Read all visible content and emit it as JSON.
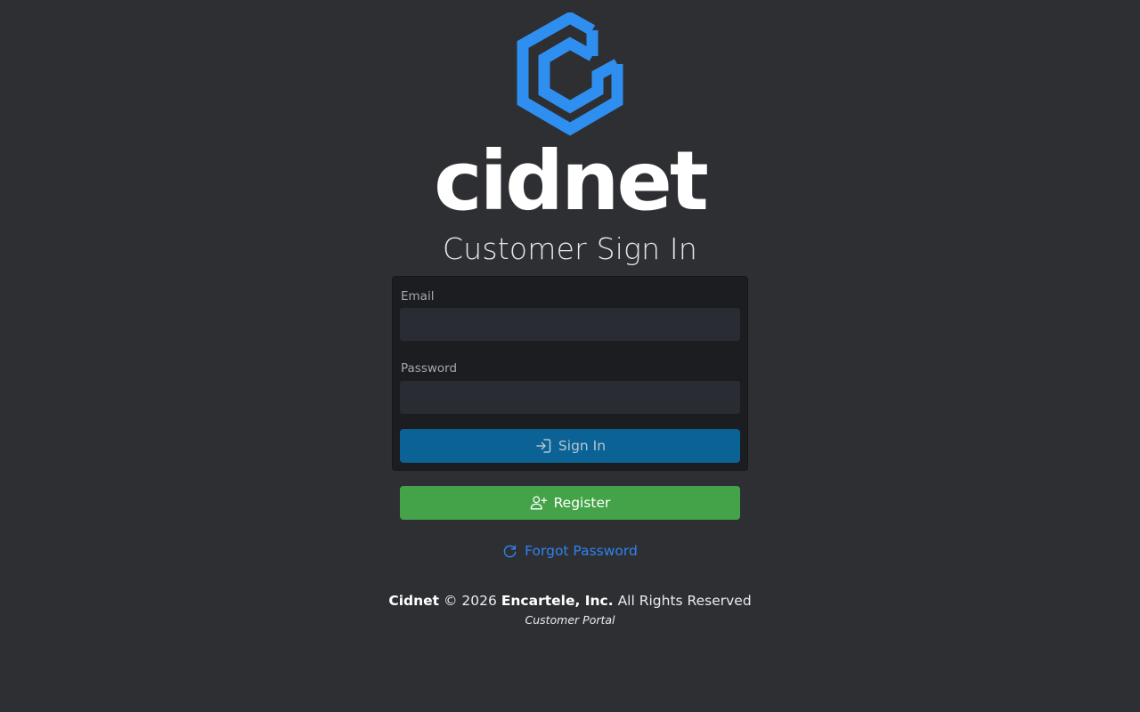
{
  "brand": {
    "name": "cidnet",
    "mark_color": "#2f8ff0"
  },
  "title": "Customer Sign In",
  "form": {
    "email_label": "Email",
    "email_value": "",
    "password_label": "Password",
    "password_value": "",
    "signin_label": "Sign In",
    "signin_icon": "sign-in-icon"
  },
  "register": {
    "label": "Register",
    "icon": "user-plus-icon"
  },
  "forgot": {
    "label": "Forgot Password",
    "icon": "refresh-icon"
  },
  "footer": {
    "brand": "Cidnet",
    "copyright": "© 2026",
    "company": "Encartele, Inc.",
    "rights": "All Rights Reserved",
    "subtitle": "Customer Portal"
  },
  "colors": {
    "background": "#2e2f33",
    "card": "#1b1d21",
    "input": "#292c32",
    "signin_button": "#0a6394",
    "register_button": "#44a349",
    "link": "#2f83ee"
  }
}
